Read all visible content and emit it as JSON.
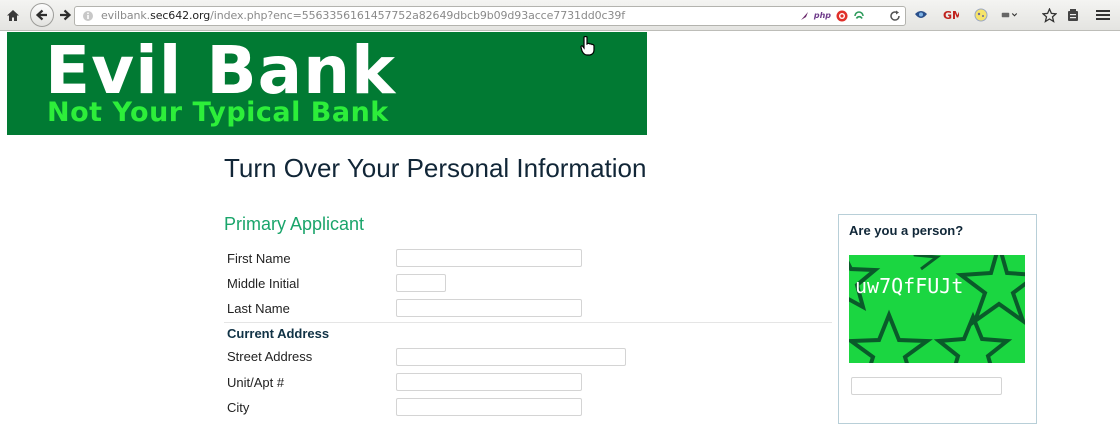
{
  "browser": {
    "url_host_pre": "evilbank.",
    "url_host": "sec642.org",
    "url_path": "/index.php?enc=5563356161457752a82649dbcb9b09d93acce7731dd0c39f",
    "addon_php_label": "php",
    "icons": [
      "home-icon",
      "back-icon",
      "forward-icon",
      "info-icon",
      "reload-icon",
      "bookmark-star-icon",
      "reader-icon",
      "menu-icon"
    ]
  },
  "banner": {
    "title": "Evil Bank",
    "tagline": "Not Your Typical Bank",
    "bg_color": "#017a33",
    "tagline_color": "#2dee3a"
  },
  "page": {
    "heading": "Turn Over Your Personal Information",
    "section_title": "Primary Applicant",
    "section_color": "#1aa56b",
    "fields": {
      "first_name": "First Name",
      "middle_initial": "Middle Initial",
      "last_name": "Last Name",
      "current_address": "Current Address",
      "street_address": "Street Address",
      "unit_apt": "Unit/Apt #",
      "city": "City"
    }
  },
  "captcha": {
    "title": "Are you a person?",
    "text": "uw7QfFUJt",
    "bg_color": "#1bd641"
  }
}
